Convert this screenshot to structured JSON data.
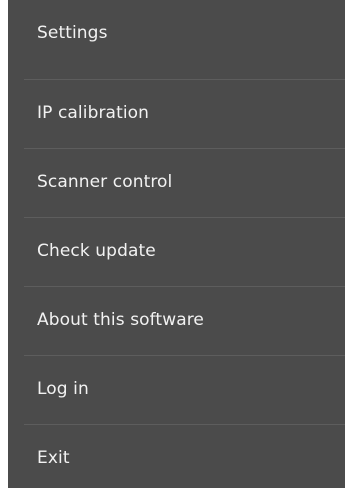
{
  "menu": {
    "items": [
      {
        "id": "settings",
        "label": "Settings"
      },
      {
        "id": "ip-calibration",
        "label": "IP calibration"
      },
      {
        "id": "scanner-control",
        "label": "Scanner control"
      },
      {
        "id": "check-update",
        "label": "Check update"
      },
      {
        "id": "about",
        "label": "About this software"
      },
      {
        "id": "log-in",
        "label": "Log in"
      },
      {
        "id": "exit",
        "label": "Exit"
      }
    ]
  },
  "colors": {
    "menu_background": "#4b4b4b",
    "text": "#f2f2f2",
    "divider": "#5d5d5d"
  }
}
